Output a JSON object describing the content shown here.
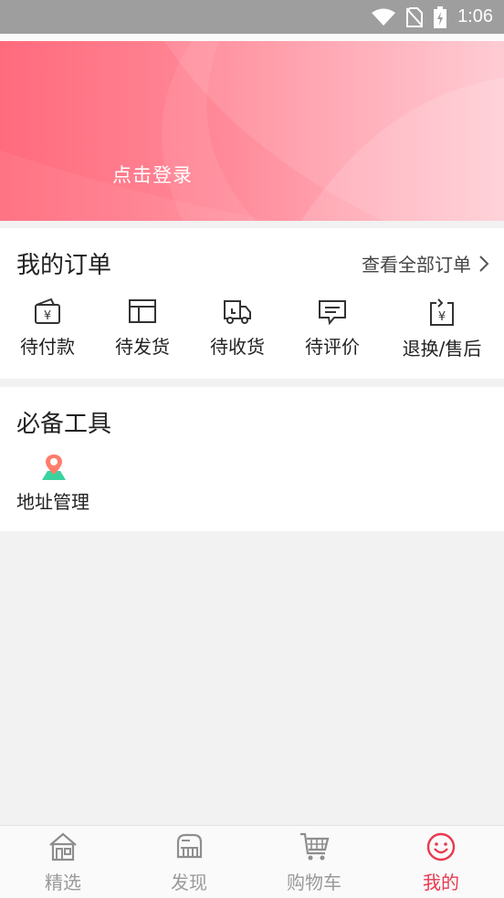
{
  "status_bar": {
    "time": "1:06"
  },
  "banner": {
    "login_label": "点击登录"
  },
  "orders": {
    "title": "我的订单",
    "view_all": "查看全部订单",
    "items": [
      {
        "label": "待付款",
        "icon": "wallet-yen-icon"
      },
      {
        "label": "待发货",
        "icon": "box-icon"
      },
      {
        "label": "待收货",
        "icon": "truck-icon"
      },
      {
        "label": "待评价",
        "icon": "comment-icon"
      },
      {
        "label": "退换/售后",
        "icon": "refund-yen-icon"
      }
    ]
  },
  "tools": {
    "title": "必备工具",
    "items": [
      {
        "label": "地址管理",
        "icon": "location-pin-icon"
      }
    ]
  },
  "tabbar": {
    "active_color": "#e8394f",
    "inactive_color": "#9a9a9a",
    "tabs": [
      {
        "label": "精选",
        "icon": "home-icon"
      },
      {
        "label": "发现",
        "icon": "discover-icon"
      },
      {
        "label": "购物车",
        "icon": "cart-icon"
      },
      {
        "label": "我的",
        "icon": "smiley-icon",
        "active": true
      }
    ]
  }
}
